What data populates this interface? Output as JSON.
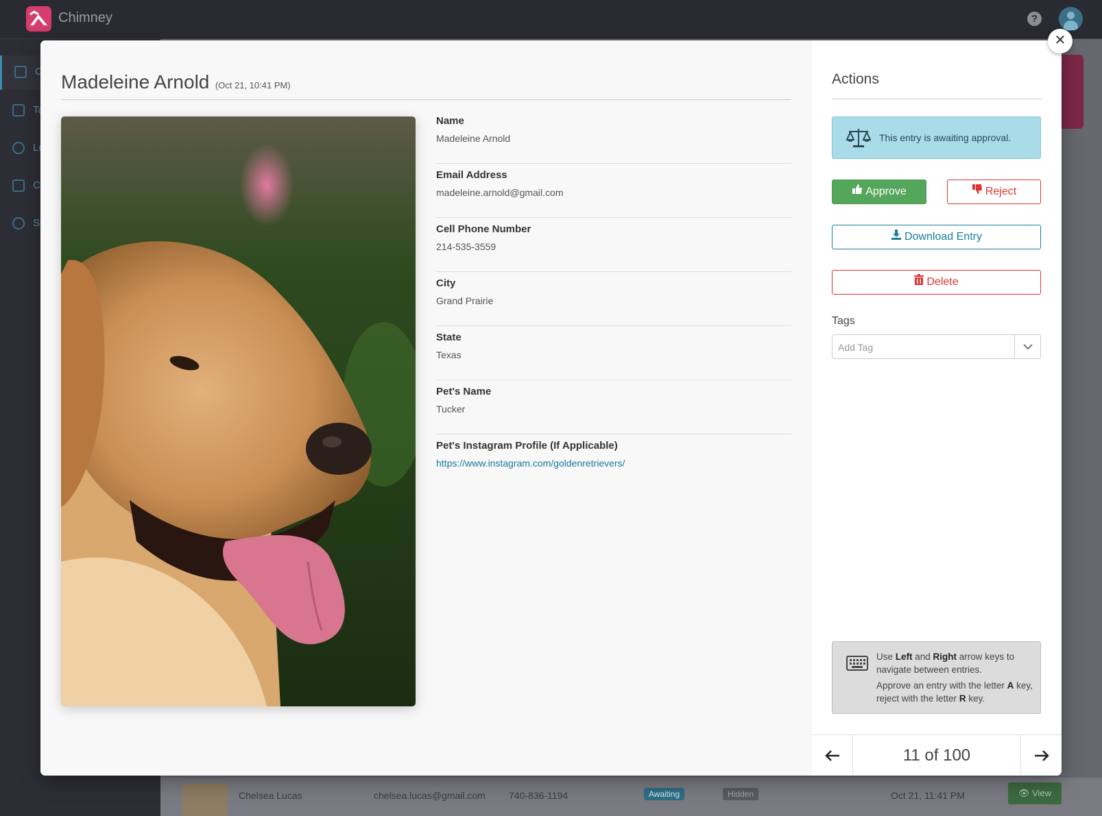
{
  "app": {
    "name": "Chimney",
    "help_icon": "question-circle-icon",
    "user_icon": "user-circle-icon",
    "brand_color": "#d63c6d"
  },
  "sidebar": {
    "items": [
      {
        "label": "C",
        "icon": "megaphone-icon"
      },
      {
        "label": "Ta",
        "icon": "tag-icon"
      },
      {
        "label": "Lo",
        "icon": "globe-icon"
      },
      {
        "label": "C",
        "icon": "users-icon"
      },
      {
        "label": "Se",
        "icon": "gears-icon"
      }
    ]
  },
  "entry": {
    "name": "Madeleine Arnold",
    "date": "(Oct 21, 10:41 PM)",
    "fields": [
      {
        "label": "Name",
        "value": "Madeleine Arnold"
      },
      {
        "label": "Email Address",
        "value": "madeleine.arnold@gmail.com"
      },
      {
        "label": "Cell Phone Number",
        "value": "214-535-3559"
      },
      {
        "label": "City",
        "value": "Grand Prairie"
      },
      {
        "label": "State",
        "value": "Texas"
      },
      {
        "label": "Pet's Name",
        "value": "Tucker"
      },
      {
        "label": "Pet's Instagram Profile (If Applicable)",
        "value": "https://www.instagram.com/goldenretrievers/"
      }
    ]
  },
  "actions": {
    "title": "Actions",
    "status": "This entry is awaiting approval.",
    "approve": "Approve",
    "reject": "Reject",
    "download": "Download Entry",
    "delete": "Delete",
    "tags_label": "Tags",
    "tag_placeholder": "Add Tag",
    "colors": {
      "approve": "#54a75a",
      "reject": "#d33333",
      "info": "#a9dbe8",
      "link": "#177c9c"
    }
  },
  "shortcuts": {
    "line1_pre": "Use ",
    "left": "Left",
    "and": " and ",
    "right": "Right",
    "line1_post": " arrow keys to navigate between entries.",
    "line2_pre": "Approve an entry with the letter ",
    "a_key": "A",
    "line2_mid": " key, reject with the letter ",
    "r_key": "R",
    "line2_post": " key."
  },
  "pager": {
    "label": "11 of 100",
    "current": 11,
    "total": 100
  },
  "background_row": {
    "name": "Chelsea Lucas",
    "email": "chelsea.lucas@gmail.com",
    "phone": "740-836-1194",
    "status": "Awaiting",
    "visibility": "Hidden",
    "date": "Oct 21, 11:41 PM",
    "view": "View"
  }
}
